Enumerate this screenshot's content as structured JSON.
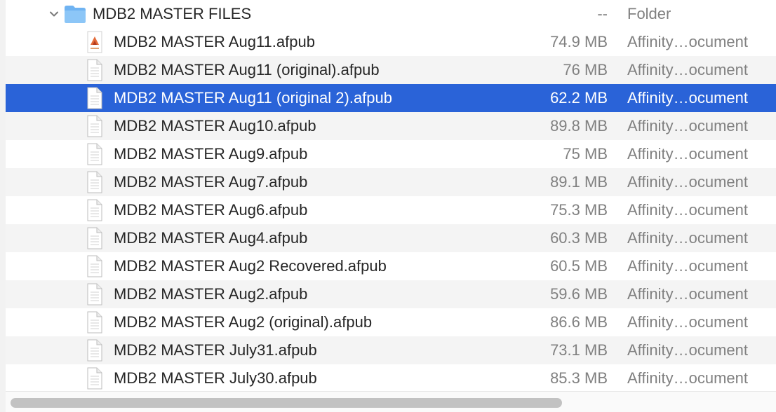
{
  "folder": {
    "name": "MDB2 MASTER FILES",
    "size": "--",
    "kind": "Folder",
    "icon": "folder-icon",
    "expanded_icon": "chevron-down-icon",
    "color": "#6fb3f2"
  },
  "files": [
    {
      "name": "MDB2 MASTER Aug11.afpub",
      "size": "74.9 MB",
      "kind": "Affinity…ocument",
      "icon": "affinity-preview-icon"
    },
    {
      "name": "MDB2 MASTER Aug11 (original).afpub",
      "size": "76 MB",
      "kind": "Affinity…ocument",
      "icon": "document-icon"
    },
    {
      "name": "MDB2 MASTER Aug11 (original 2).afpub",
      "size": "62.2 MB",
      "kind": "Affinity…ocument",
      "icon": "document-icon"
    },
    {
      "name": "MDB2 MASTER Aug10.afpub",
      "size": "89.8 MB",
      "kind": "Affinity…ocument",
      "icon": "document-icon"
    },
    {
      "name": "MDB2 MASTER Aug9.afpub",
      "size": "75 MB",
      "kind": "Affinity…ocument",
      "icon": "document-icon"
    },
    {
      "name": "MDB2 MASTER Aug7.afpub",
      "size": "89.1 MB",
      "kind": "Affinity…ocument",
      "icon": "document-icon"
    },
    {
      "name": "MDB2 MASTER Aug6.afpub",
      "size": "75.3 MB",
      "kind": "Affinity…ocument",
      "icon": "document-icon"
    },
    {
      "name": "MDB2 MASTER Aug4.afpub",
      "size": "60.3 MB",
      "kind": "Affinity…ocument",
      "icon": "document-icon"
    },
    {
      "name": "MDB2 MASTER Aug2 Recovered.afpub",
      "size": "60.5 MB",
      "kind": "Affinity…ocument",
      "icon": "document-icon"
    },
    {
      "name": "MDB2 MASTER Aug2.afpub",
      "size": "59.6 MB",
      "kind": "Affinity…ocument",
      "icon": "document-icon"
    },
    {
      "name": "MDB2 MASTER Aug2 (original).afpub",
      "size": "86.6 MB",
      "kind": "Affinity…ocument",
      "icon": "document-icon"
    },
    {
      "name": "MDB2 MASTER July31.afpub",
      "size": "73.1 MB",
      "kind": "Affinity…ocument",
      "icon": "document-icon"
    },
    {
      "name": "MDB2 MASTER July30.afpub",
      "size": "85.3 MB",
      "kind": "Affinity…ocument",
      "icon": "document-icon"
    }
  ],
  "selected_index": 2,
  "colors": {
    "selection": "#2a63d8",
    "alt_row": "#f4f4f4",
    "secondary_text": "#808080",
    "primary_text": "#262626"
  },
  "scrollbar": {
    "icon": "horizontal-scrollbar"
  }
}
